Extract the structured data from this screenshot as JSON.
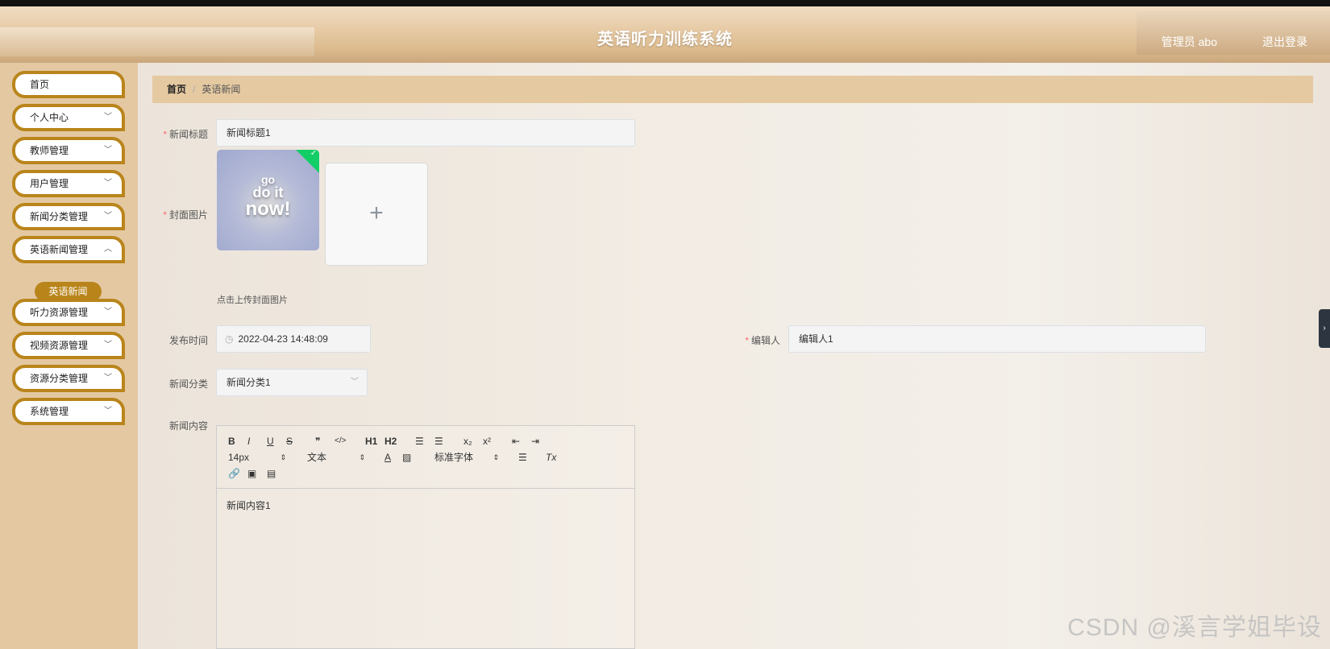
{
  "header": {
    "title": "英语听力训练系统",
    "user": "管理员 abo",
    "logout": "退出登录"
  },
  "sidebar": {
    "items": [
      {
        "label": "首页"
      },
      {
        "label": "个人中心"
      },
      {
        "label": "教师管理"
      },
      {
        "label": "用户管理"
      },
      {
        "label": "新闻分类管理"
      },
      {
        "label": "英语新闻管理"
      },
      {
        "label": "听力资源管理"
      },
      {
        "label": "视频资源管理"
      },
      {
        "label": "资源分类管理"
      },
      {
        "label": "系统管理"
      }
    ],
    "active_sub": "英语新闻"
  },
  "breadcrumb": {
    "home": "首页",
    "sep": "/",
    "current": "英语新闻"
  },
  "form": {
    "title_label": "新闻标题",
    "title_value": "新闻标题1",
    "cover_label": "封面图片",
    "cover_art": [
      "go",
      "do it",
      "now!"
    ],
    "upload_plus": "+",
    "upload_tip": "点击上传封面图片",
    "publish_label": "发布时间",
    "publish_value": "2022-04-23 14:48:09",
    "editor_label": "编辑人",
    "editor_value": "编辑人1",
    "category_label": "新闻分类",
    "category_value": "新闻分类1",
    "content_label": "新闻内容",
    "content_value": "新闻内容1"
  },
  "toolbar": {
    "bold": "B",
    "italic": "I",
    "underline": "U",
    "strike": "S",
    "quote": "❞",
    "code": "</>",
    "h1": "H1",
    "h2": "H2",
    "ol": "☰",
    "ul": "☰",
    "sub": "x₂",
    "sup": "x²",
    "outdent": "⇤",
    "indent": "⇥",
    "size": "14px",
    "header": "文本",
    "font": "标准字体",
    "align": "☰",
    "clean": "Tx",
    "link": "🔗",
    "image": "▣",
    "video": "▤"
  },
  "watermark": "CSDN @溪言学姐毕设",
  "colors": {
    "accent": "#b9851b",
    "sidebar_bg": "#e4c8a2",
    "breadcrumb_bg": "#e5c9a1",
    "required": "#f56c6c",
    "success": "#13ce66"
  }
}
